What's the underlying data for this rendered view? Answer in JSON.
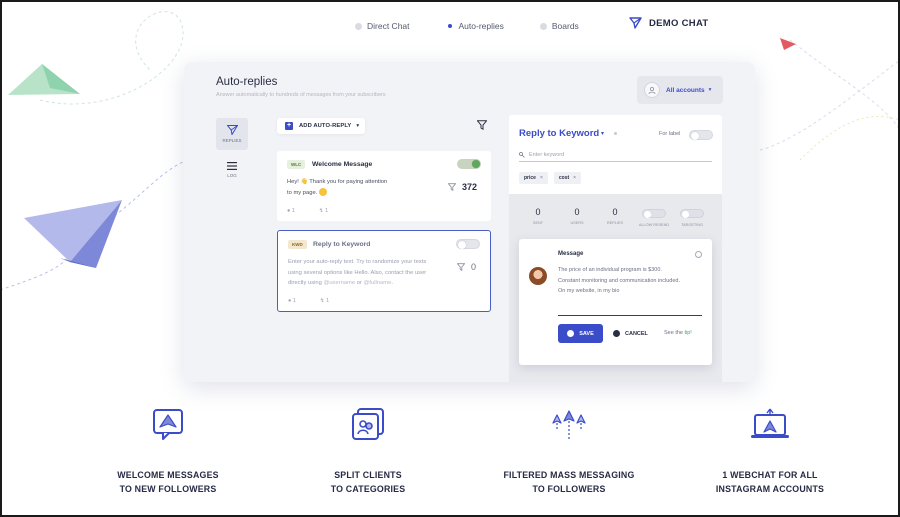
{
  "topnav": {
    "items": [
      {
        "label": "Direct Chat"
      },
      {
        "label": "Auto-replies"
      },
      {
        "label": "Boards"
      }
    ],
    "brand": "DEMO CHAT"
  },
  "card": {
    "title": "Auto-replies",
    "subtitle": "Answer automatically to hundreds of messages from your subscribers",
    "accounts_label": "All accounts",
    "sidenav": [
      {
        "label": "REPLIES"
      },
      {
        "label": "LOG"
      }
    ],
    "add_button": "ADD AUTO-REPLY",
    "replies": [
      {
        "tag": "WLC",
        "title": "Welcome Message",
        "text_1": "Hey! 👋 Thank you for paying attention",
        "text_2": "to my page.",
        "count": "372",
        "stat_a": "1",
        "stat_b": "1",
        "enabled": true
      },
      {
        "tag": "KWD",
        "title": "Reply to Keyword",
        "text_1": "Enter your auto-reply text. Try to randomize your texts",
        "text_2": "using several options like Hello. Also, contact the user",
        "text_3_a": "directly using ",
        "text_3_b": "@username",
        "text_3_c": " or ",
        "text_3_d": "@fullname",
        "text_3_e": ".",
        "count": "0",
        "stat_a": "1",
        "stat_b": "1",
        "enabled": false
      }
    ],
    "panel": {
      "title": "Reply to Keyword",
      "for_label": "For label",
      "keyword_placeholder": "Enter keyword",
      "chips": [
        "price",
        "cost"
      ],
      "stats": [
        {
          "num": "0",
          "label": "SENT"
        },
        {
          "num": "0",
          "label": "USERS"
        },
        {
          "num": "0",
          "label": "REPLIES"
        }
      ],
      "toggles": [
        {
          "label": "ALLOW RESEND"
        },
        {
          "label": "TARGETING"
        }
      ],
      "message": {
        "title": "Message",
        "line_1": "The price of an individual program is $300.",
        "line_2": "Constant monitoring and communication included.",
        "line_3": "On my website, in my bio",
        "save": "SAVE",
        "cancel": "CANCEL",
        "see_the": "See the",
        "tip": "tip!"
      }
    }
  },
  "features": [
    {
      "line_1": "WELCOME MESSAGES",
      "line_2": "TO NEW FOLLOWERS"
    },
    {
      "line_1": "SPLIT CLIENTS",
      "line_2": "TO CATEGORIES"
    },
    {
      "line_1": "FILTERED MASS MESSAGING",
      "line_2": "TO FOLLOWERS"
    },
    {
      "line_1": "1 WEBCHAT FOR ALL",
      "line_2": "INSTAGRAM ACCOUNTS"
    }
  ],
  "colors": {
    "accent": "#3b4cc8",
    "plane_green": "#8fd3ae",
    "plane_purple": "#7e88d8",
    "plane_red": "#e45a63",
    "toggle_on": "#5fa85b"
  }
}
